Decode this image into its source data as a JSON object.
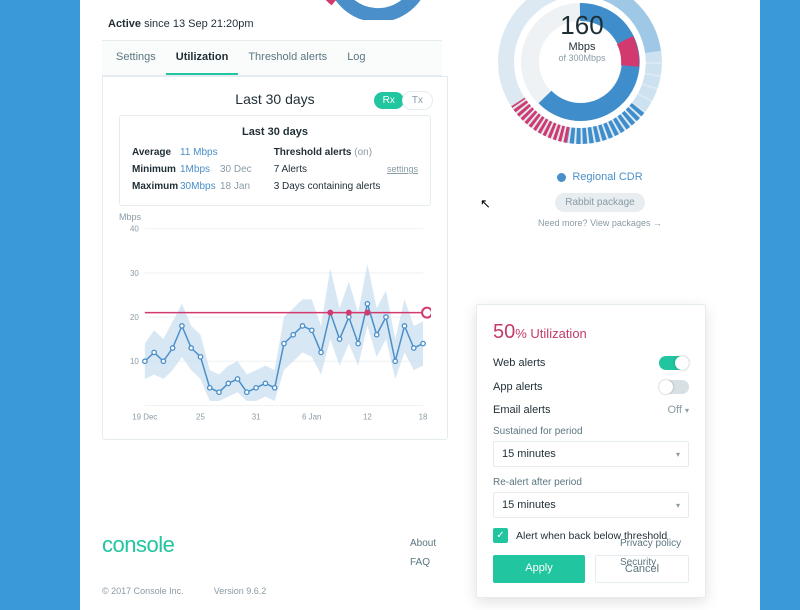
{
  "status": {
    "state": "Active",
    "since": "since 13 Sep 21:20pm"
  },
  "tabs": [
    "Settings",
    "Utilization",
    "Threshold alerts",
    "Log"
  ],
  "chart": {
    "title": "Last 30 days",
    "rx": "Rx",
    "tx": "Tx",
    "ylabel": "Mbps",
    "stats_title": "Last 30 days",
    "avg_lbl": "Average",
    "avg_v": "11 Mbps",
    "min_lbl": "Minimum",
    "min_v": "1Mbps",
    "min_d": "30 Dec",
    "max_lbl": "Maximum",
    "max_v": "30Mbps",
    "max_d": "18 Jan",
    "thr_lbl": "Threshold alerts",
    "thr_state": "(on)",
    "thr_v1": "7 Alerts",
    "thr_v2": "3 Days containing alerts",
    "settings_link": "settings"
  },
  "chart_data": {
    "type": "line",
    "ylabel": "Mbps",
    "ylim": [
      0,
      40
    ],
    "x": [
      "19 Dec",
      "20",
      "21",
      "22",
      "23",
      "24",
      "25",
      "26",
      "27",
      "28",
      "29",
      "30",
      "31",
      "1 Jan",
      "2",
      "3",
      "4",
      "5",
      "6 Jan",
      "7",
      "8",
      "9",
      "10",
      "11",
      "12",
      "13",
      "14",
      "15",
      "16",
      "17",
      "18"
    ],
    "xticks": [
      "19 Dec",
      "25",
      "31",
      "6 Jan",
      "12",
      "18"
    ],
    "xtick_idx": [
      0,
      6,
      12,
      18,
      24,
      30
    ],
    "threshold": 21,
    "series": [
      {
        "name": "Rx",
        "values": [
          10,
          12,
          10,
          13,
          18,
          13,
          11,
          4,
          3,
          5,
          6,
          3,
          4,
          5,
          4,
          14,
          16,
          18,
          17,
          12,
          21,
          15,
          20,
          14,
          23,
          16,
          20,
          10,
          18,
          13,
          14
        ]
      }
    ],
    "band_lo": [
      6,
      7,
      6,
      8,
      11,
      8,
      6,
      1,
      1,
      2,
      3,
      1,
      1,
      2,
      1,
      8,
      10,
      12,
      11,
      7,
      15,
      9,
      14,
      9,
      18,
      11,
      15,
      6,
      12,
      8,
      9
    ],
    "band_hi": [
      14,
      17,
      15,
      19,
      23,
      18,
      16,
      8,
      7,
      9,
      10,
      7,
      8,
      9,
      8,
      20,
      22,
      24,
      24,
      18,
      31,
      22,
      28,
      21,
      32,
      22,
      26,
      15,
      24,
      18,
      19
    ],
    "threshold_hits_idx": [
      20,
      22,
      24
    ]
  },
  "gauge": {
    "value": "160",
    "unit": "Mbps",
    "of": "of 300Mbps",
    "legend": "Regional CDR",
    "pkg": "Rabbit package",
    "need": "Need more?",
    "view": "View packages  →"
  },
  "popover": {
    "pct": "50",
    "pct_suffix": "% Utilization",
    "web": "Web alerts",
    "app": "App alerts",
    "email": "Email alerts",
    "email_state": "Off",
    "sustained_lbl": "Sustained for period",
    "sustained_v": "15 minutes",
    "realert_lbl": "Re-alert after period",
    "realert_v": "15 minutes",
    "chk_lbl": "Alert when back below threshold",
    "apply": "Apply",
    "cancel": "Cancel"
  },
  "footer": {
    "logo": "console",
    "copyright": "© 2017 Console Inc.",
    "version": "Version 9.6.2",
    "col1": [
      "About",
      "FAQ"
    ],
    "col2": [
      "Privacy policy",
      "Security"
    ]
  }
}
